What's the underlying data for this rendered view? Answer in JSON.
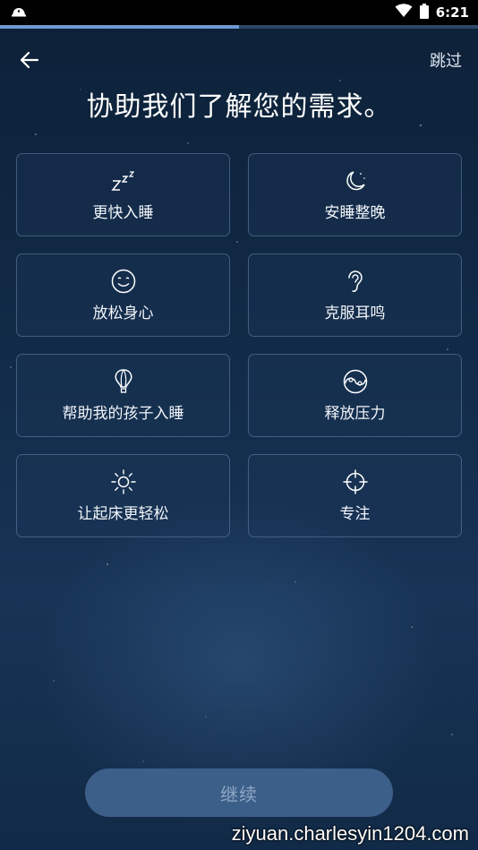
{
  "status_bar": {
    "time": "6:21"
  },
  "onboarding": {
    "progress": 0.5
  },
  "header": {
    "skip_label": "跳过",
    "title": "协助我们了解您的需求。"
  },
  "options": [
    {
      "label": "更快入睡",
      "icon": "zzz-icon"
    },
    {
      "label": "安睡整晚",
      "icon": "moon-stars-icon"
    },
    {
      "label": "放松身心",
      "icon": "smile-icon"
    },
    {
      "label": "克服耳鸣",
      "icon": "ear-icon"
    },
    {
      "label": "帮助我的孩子入睡",
      "icon": "hot-air-balloon-icon"
    },
    {
      "label": "释放压力",
      "icon": "yin-yang-icon"
    },
    {
      "label": "让起床更轻松",
      "icon": "sun-icon"
    },
    {
      "label": "专注",
      "icon": "crosshair-icon"
    }
  ],
  "footer": {
    "continue_label": "继续"
  },
  "watermark": "ziyuan.charlesyin1204.com",
  "colors": {
    "background": "#112a47",
    "accent": "#6e9ad2",
    "button": "#3c5f89"
  }
}
